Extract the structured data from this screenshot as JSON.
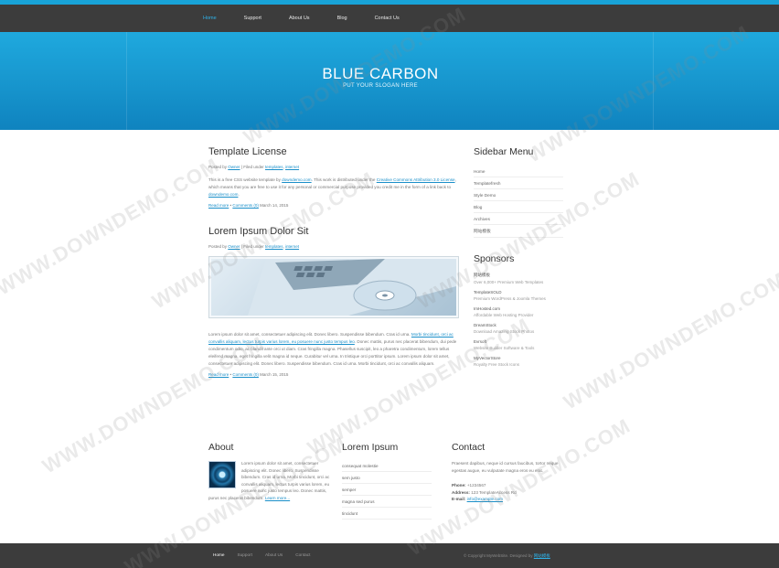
{
  "nav": {
    "items": [
      "Home",
      "Support",
      "About Us",
      "Blog",
      "Contact Us"
    ],
    "active": "Home"
  },
  "hero": {
    "title": "BLUE CARBON",
    "slogan": "PUT YOUR SLOGAN HERE"
  },
  "posts": [
    {
      "title": "Template License",
      "meta_prefix": "Posted by",
      "author": "Owner",
      "meta_mid": "| Filed under",
      "tag1": "templates",
      "tag2": "internet",
      "body_parts": [
        "This is a free CSS website template by ",
        "downdemo.com",
        ". This work is distributed under the ",
        "Creative Commons Attribution 3.0 License",
        ", which means that you are free to use it for any personal or commercial purpose provided you credit me in the form of a link back to ",
        "downdemo.com",
        "."
      ],
      "read_more": "Read more",
      "comments": "Comments (0)",
      "date": "March 14, 2015"
    },
    {
      "title": "Lorem Ipsum Dolor Sit",
      "meta_prefix": "Posted by",
      "author": "Owner",
      "meta_mid": "| Filed under",
      "tag1": "templates",
      "tag2": "internet",
      "body_parts": [
        "Lorem ipsum dolor sit amet, consectetuer adipiscing elit. Donec libero. Suspendisse bibendum. Cras id urna. ",
        "Morbi tincidunt, orci ac convallis aliquam, lectus turpis varius lorem, eu posuere nunc justo tempus leo",
        ". Donec mattis, purus nec placerat bibendum, dui pede condimentum odio, ac blandit ante orci ut diam. Cras fringilla magna. Phasellus suscipit, leo a pharetra condimentum, lorem tellus eleifend magna, eget fringilla velit magna id neque. Curabitur vel urna. In tristique orci porttitor ipsum. Lorem ipsum dolor sit amet, consectetuer adipiscing elit. Donec libero. Suspendisse bibendum. Cras id urna. Morbi tincidunt, orci ac convallis aliquam."
      ],
      "read_more": "Read more",
      "comments": "Comments (0)",
      "date": "March 15, 2015"
    }
  ],
  "sidebar": {
    "menu_title": "Sidebar Menu",
    "menu_items": [
      "Home",
      "Templatefresh",
      "Style Demo",
      "Blog",
      "Archives",
      "网站模板"
    ],
    "sponsors_title": "Sponsors",
    "sponsors": [
      {
        "name": "网站模板",
        "desc": "Over 6,000+ Premium Web Templates"
      },
      {
        "name": "TemplateSOLD",
        "desc": "Premium WordPress & Joomla Themes"
      },
      {
        "name": "ImHosted.com",
        "desc": "Affordable Web Hosting Provider"
      },
      {
        "name": "DreamStock",
        "desc": "Download Amazing Stock Photos"
      },
      {
        "name": "Evrsoft",
        "desc": "Website Builder Software & Tools"
      },
      {
        "name": "MyVectorStore",
        "desc": "Royalty Free Stock Icons"
      }
    ]
  },
  "about": {
    "title": "About",
    "text_parts": [
      "Lorem ipsum dolor sit amet, consectetuer adipiscing elit. Donec libero. Suspendisse bibendum. Cras id urna. Morbi tincidunt, orci ac convallis aliquam, lectus turpis varius lorem, eu posuere nunc justo tempus leo. Donec mattis, purus nec placerat bibendum. ",
      "Learn more..."
    ]
  },
  "lorem": {
    "title": "Lorem Ipsum",
    "items": [
      "consequat molestie",
      "sem justo",
      "semper",
      "magna sed purus",
      "tincidunt"
    ]
  },
  "contact": {
    "title": "Contact",
    "text": "Praesent dapibus, neque id cursus faucibus, tortor neque egestas augue, eu vulputate magna eros eu erat.",
    "phone_label": "Phone:",
    "phone": "+1234567",
    "address_label": "Address:",
    "address": "123 TemplateAccess Rd",
    "email_label": "E-mail:",
    "email": "info@example.com"
  },
  "footer": {
    "links": [
      "Home",
      "Support",
      "About Us",
      "Contact"
    ],
    "copyright_text": "© Copyright MyWebSite. Designed by",
    "copyright_link": "网站模板"
  },
  "watermark": "WWW.DOWNDEMO.COM"
}
